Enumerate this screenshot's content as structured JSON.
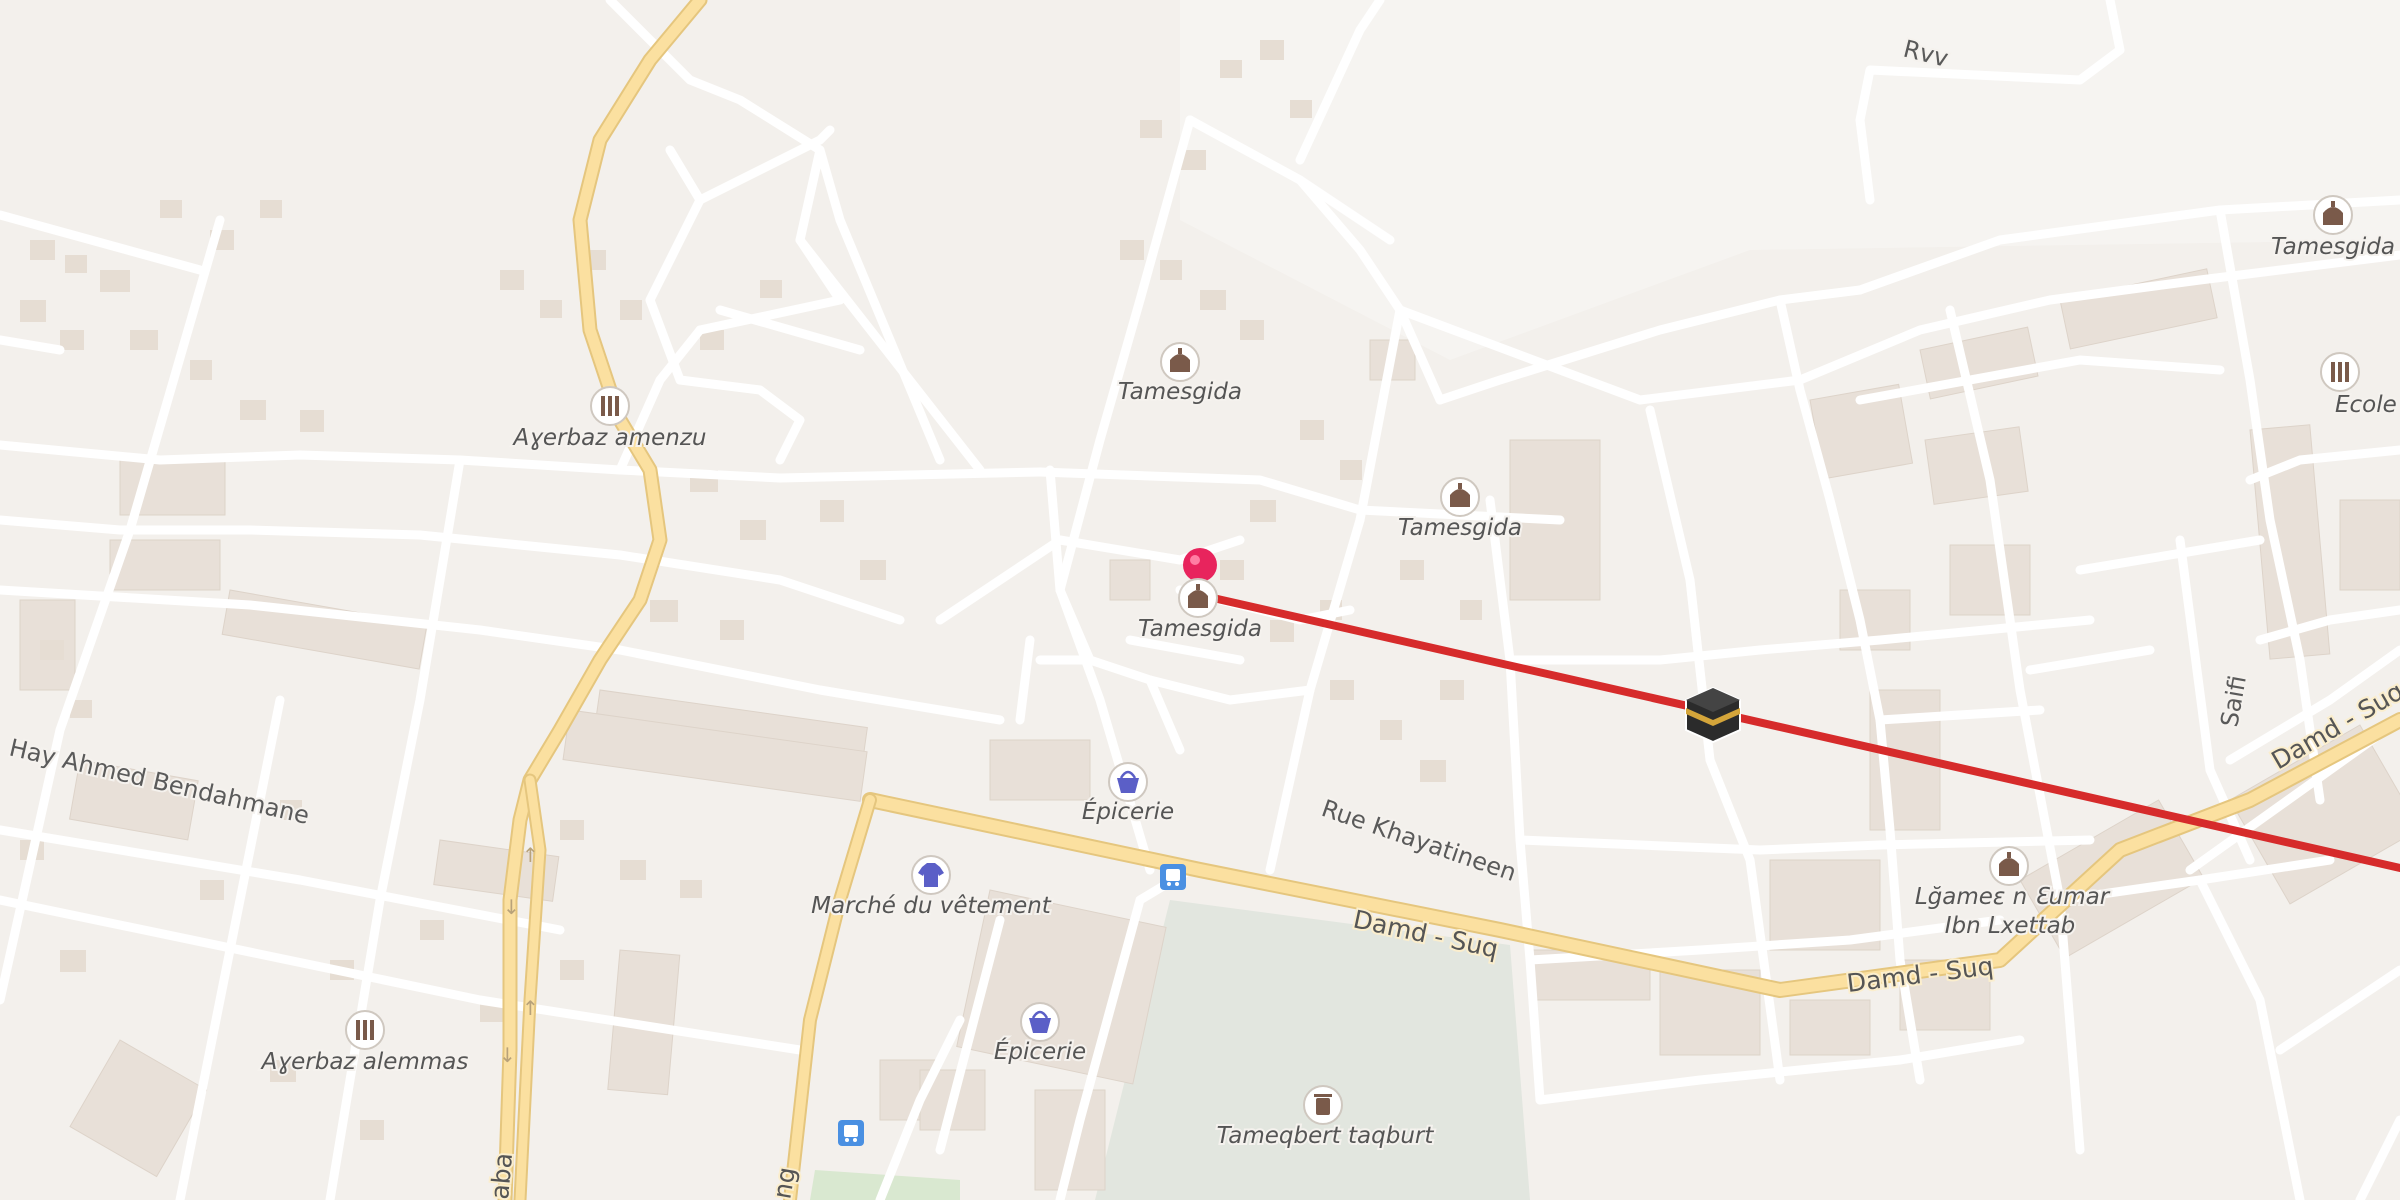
{
  "map": {
    "route_color": "#d62b2b",
    "pin_color": "#e8245d",
    "major_road_color": "#fbe0a0",
    "minor_road_color": "#ffffff",
    "park_color": "#e2e6df",
    "building_color": "#e8e0d8"
  },
  "streets": {
    "hay_ahmed": "Hay Ahmed Bendahmane",
    "rue_khayatineen": "Rue Khayatineen",
    "damd_suq_1": "Damd - Suq",
    "damd_suq_2": "Damd - Suq",
    "damd_suq_3": "Damd - Suq",
    "rvv": "Rvv",
    "saifi": "Saifi",
    "left_vertical": "aba",
    "bottom_vertical": "ng"
  },
  "pois": {
    "mosque_center": {
      "label": "Tamesgida",
      "icon": "mosque-icon"
    },
    "mosque_upper": {
      "label": "Tamesgida",
      "icon": "mosque-icon"
    },
    "mosque_right": {
      "label": "Tamesgida",
      "icon": "mosque-icon"
    },
    "mosque_far_right": {
      "label": "Tamesgida",
      "icon": "mosque-icon"
    },
    "mosque_bottom_right": {
      "label_line1": "Lğameε n Ɛumar",
      "label_line2": "Ibn Lxettab",
      "icon": "mosque-icon"
    },
    "school_amenzu": {
      "label": "Aɣerbaz amenzu",
      "icon": "school-icon"
    },
    "school_alemmas": {
      "label": "Aɣerbaz alemmas",
      "icon": "school-icon"
    },
    "school_ecole": {
      "label": "Ecole Moyen",
      "icon": "school-icon"
    },
    "grocery_1": {
      "label": "Épicerie",
      "icon": "basket-icon"
    },
    "grocery_2": {
      "label": "Épicerie",
      "icon": "basket-icon"
    },
    "clothes": {
      "label": "Marché du vêtement",
      "icon": "shirt-icon"
    },
    "cemetery": {
      "label": "Tameqbert taqburt",
      "icon": "cemetery-icon"
    }
  }
}
